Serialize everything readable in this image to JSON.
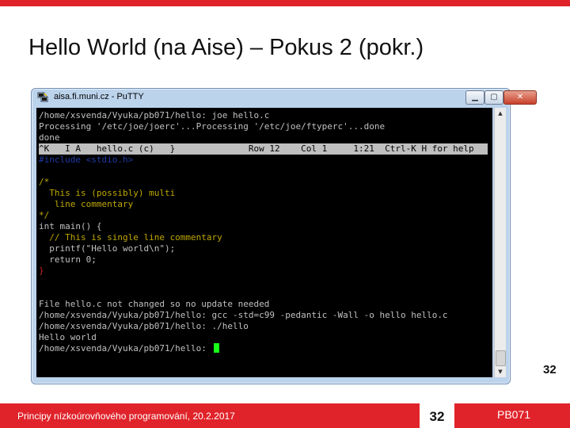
{
  "slide": {
    "title": "Hello World (na Aise) – Pokus 2 (pokr.)",
    "slide_number": "32",
    "footer_text": "Principy nízkoúrovňového programování, 20.2.2017",
    "footer_number": "32",
    "course_code": "PB071",
    "accent_color": "#e0232a"
  },
  "window": {
    "title": "aisa.fi.muni.cz - PuTTY",
    "app_icon": "putty-icon",
    "minimize_glyph": "▁",
    "maximize_glyph": "▢",
    "close_glyph": "✕"
  },
  "terminal": {
    "lines": [
      "/home/xsvenda/Vyuka/pb071/hello: joe hello.c",
      "Processing '/etc/joe/joerc'...Processing '/etc/joe/ftyperc'...done",
      "done",
      "^K   I A   hello.c (c)   }              Row 12    Col 1     1:21  Ctrl-K H for help",
      "#include <stdio.h>",
      "",
      "/*",
      "  This is (possibly) multi",
      "   line commentary",
      "*/",
      "int main() {",
      "  // This is single line commentary",
      "  printf(\"Hello world\\n\");",
      "  return 0;",
      "}",
      "",
      "",
      "File hello.c not changed so no update needed",
      "/home/xsvenda/Vyuka/pb071/hello: gcc -std=c99 -pedantic -Wall -o hello hello.c",
      "/home/xsvenda/Vyuka/pb071/hello: ./hello",
      "Hello world",
      "/home/xsvenda/Vyuka/pb071/hello: "
    ],
    "syntax_colors": {
      "include": "#1f3aa8",
      "comment": "#c0a800",
      "string": "#66d9ef",
      "brace": "#cc2222",
      "cursor": "#18ff18"
    }
  },
  "scrollbar": {
    "up_glyph": "▲",
    "down_glyph": "▼"
  }
}
